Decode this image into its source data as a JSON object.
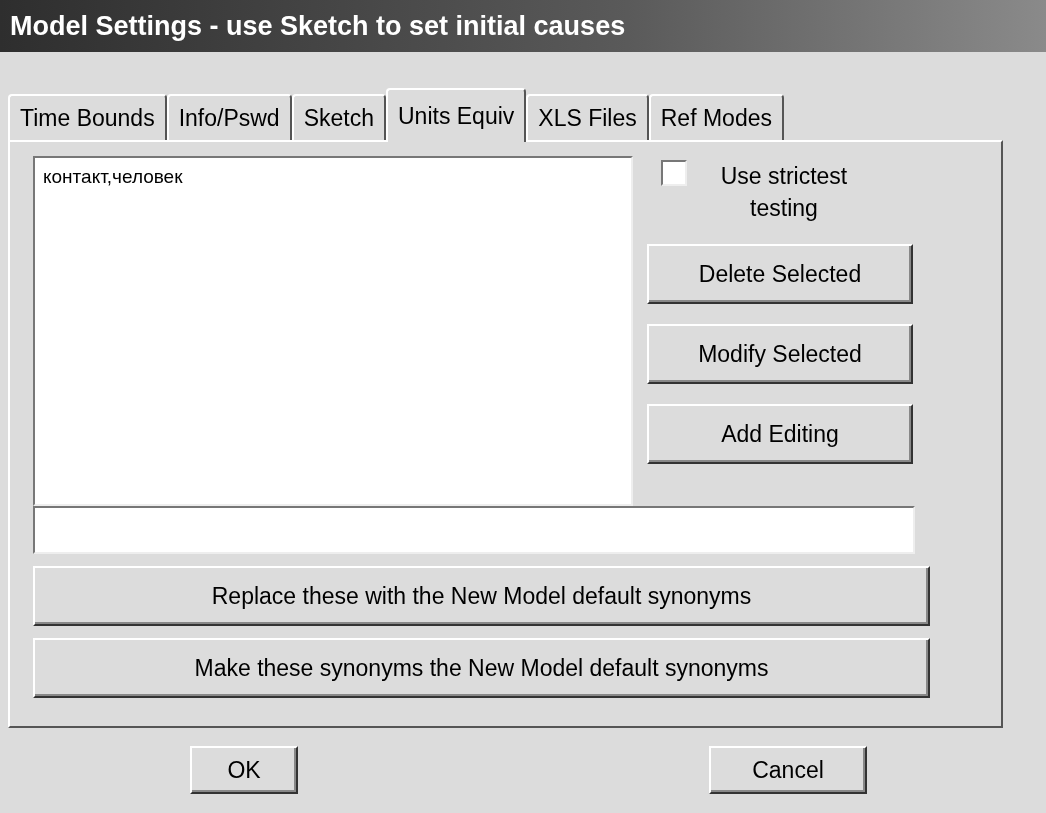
{
  "window": {
    "title": "Model Settings - use Sketch to set initial causes"
  },
  "tabs": [
    {
      "label": "Time Bounds",
      "selected": false
    },
    {
      "label": "Info/Pswd",
      "selected": false
    },
    {
      "label": "Sketch",
      "selected": false
    },
    {
      "label": "Units Equiv",
      "selected": true
    },
    {
      "label": "XLS Files",
      "selected": false
    },
    {
      "label": "Ref Modes",
      "selected": false
    }
  ],
  "units_list": {
    "items": [
      "контакт,человек"
    ]
  },
  "strictest_testing": {
    "label": "Use strictest testing",
    "checked": false
  },
  "side_buttons": [
    "Delete Selected",
    "Modify Selected",
    "Add Editing"
  ],
  "wide_buttons": [
    "Replace these with the New Model default synonyms",
    "Make these synonyms the New Model default synonyms"
  ],
  "dialog_buttons": [
    "OK",
    "Cancel"
  ]
}
